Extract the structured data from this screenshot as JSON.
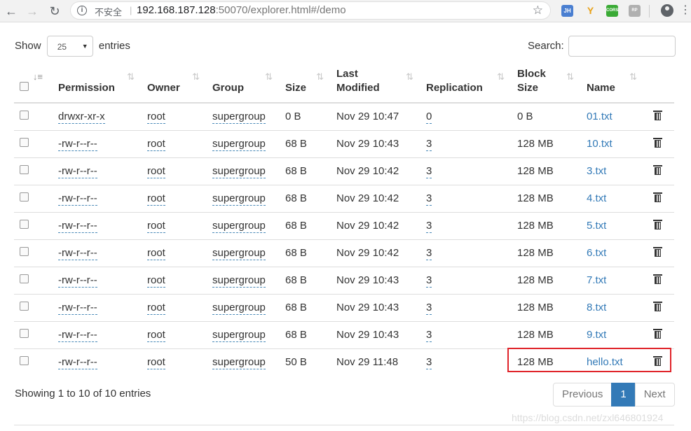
{
  "browser": {
    "security_label": "不安全",
    "url_host": "192.168.187.128",
    "url_path": ":50070/explorer.html#/demo",
    "extensions": [
      "JH",
      "Y",
      "CORS",
      "RP"
    ]
  },
  "controls": {
    "show_label": "Show",
    "entries_label": "entries",
    "page_length": "25",
    "search_label": "Search:",
    "search_value": ""
  },
  "table": {
    "headers": {
      "permission": "Permission",
      "owner": "Owner",
      "group": "Group",
      "size": "Size",
      "last_modified_1": "Last",
      "last_modified_2": "Modified",
      "replication": "Replication",
      "block_size_1": "Block",
      "block_size_2": "Size",
      "name": "Name"
    },
    "rows": [
      {
        "permission": "drwxr-xr-x",
        "owner": "root",
        "group": "supergroup",
        "size": "0 B",
        "modified": "Nov 29 10:47",
        "replication": "0",
        "block_size": "0 B",
        "name": "01.txt"
      },
      {
        "permission": "-rw-r--r--",
        "owner": "root",
        "group": "supergroup",
        "size": "68 B",
        "modified": "Nov 29 10:43",
        "replication": "3",
        "block_size": "128 MB",
        "name": "10.txt"
      },
      {
        "permission": "-rw-r--r--",
        "owner": "root",
        "group": "supergroup",
        "size": "68 B",
        "modified": "Nov 29 10:42",
        "replication": "3",
        "block_size": "128 MB",
        "name": "3.txt"
      },
      {
        "permission": "-rw-r--r--",
        "owner": "root",
        "group": "supergroup",
        "size": "68 B",
        "modified": "Nov 29 10:42",
        "replication": "3",
        "block_size": "128 MB",
        "name": "4.txt"
      },
      {
        "permission": "-rw-r--r--",
        "owner": "root",
        "group": "supergroup",
        "size": "68 B",
        "modified": "Nov 29 10:42",
        "replication": "3",
        "block_size": "128 MB",
        "name": "5.txt"
      },
      {
        "permission": "-rw-r--r--",
        "owner": "root",
        "group": "supergroup",
        "size": "68 B",
        "modified": "Nov 29 10:42",
        "replication": "3",
        "block_size": "128 MB",
        "name": "6.txt"
      },
      {
        "permission": "-rw-r--r--",
        "owner": "root",
        "group": "supergroup",
        "size": "68 B",
        "modified": "Nov 29 10:43",
        "replication": "3",
        "block_size": "128 MB",
        "name": "7.txt"
      },
      {
        "permission": "-rw-r--r--",
        "owner": "root",
        "group": "supergroup",
        "size": "68 B",
        "modified": "Nov 29 10:43",
        "replication": "3",
        "block_size": "128 MB",
        "name": "8.txt"
      },
      {
        "permission": "-rw-r--r--",
        "owner": "root",
        "group": "supergroup",
        "size": "68 B",
        "modified": "Nov 29 10:43",
        "replication": "3",
        "block_size": "128 MB",
        "name": "9.txt"
      },
      {
        "permission": "-rw-r--r--",
        "owner": "root",
        "group": "supergroup",
        "size": "50 B",
        "modified": "Nov 29 11:48",
        "replication": "3",
        "block_size": "128 MB",
        "name": "hello.txt"
      }
    ]
  },
  "footer": {
    "info": "Showing 1 to 10 of 10 entries",
    "previous": "Previous",
    "current_page": "1",
    "next": "Next"
  },
  "watermark": "https://blog.csdn.net/zxl646801924",
  "colors": {
    "highlight": "#e0242a",
    "accent": "#337ab7"
  }
}
